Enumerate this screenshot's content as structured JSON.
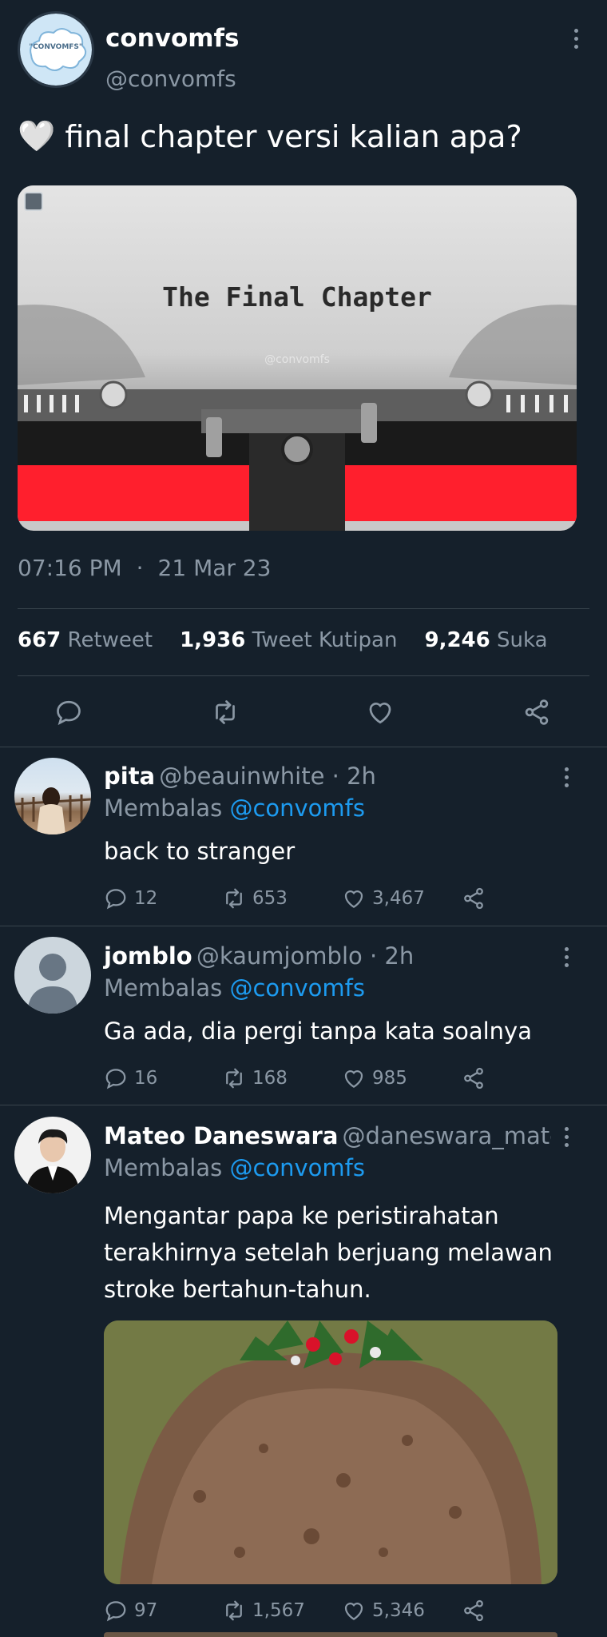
{
  "tweet": {
    "display_name": "convomfs",
    "handle": "@convomfs",
    "avatar_text": "\"CONVOMFS\"",
    "text_emoji": "🤍",
    "text": "final chapter versi kalian apa?",
    "image_caption": "The Final Chapter",
    "image_watermark": "@convomfs",
    "time": "07:16 PM",
    "separator": "·",
    "date": "21 Mar 23",
    "stats": {
      "retweets_count": "667",
      "retweets_label": "Retweet",
      "quotes_count": "1,936",
      "quotes_label": "Tweet Kutipan",
      "likes_count": "9,246",
      "likes_label": "Suka"
    }
  },
  "replies": [
    {
      "name": "pita",
      "meta": "@beauinwhite · 2h",
      "replying_label": "Membalas",
      "replying_to": "@convomfs",
      "text": "back to stranger",
      "replies": "12",
      "retweets": "653",
      "likes": "3,467"
    },
    {
      "name": "jomblo",
      "meta": "@kaumjomblo · 2h",
      "replying_label": "Membalas",
      "replying_to": "@convomfs",
      "text": "Ga ada, dia pergi tanpa kata soalnya",
      "replies": "16",
      "retweets": "168",
      "likes": "985"
    },
    {
      "name": "Mateo Daneswara",
      "meta": "@daneswara_mateo...",
      "replying_label": "Membalas",
      "replying_to": "@convomfs",
      "text_lines": [
        "Mengantar papa ke peristirahatan",
        "terakhirnya setelah berjuang melawan",
        "stroke bertahun-tahun."
      ],
      "replies": "97",
      "retweets": "1,567",
      "likes": "5,346"
    }
  ],
  "colors": {
    "background": "#15202b",
    "divider": "#38444d",
    "muted": "#8b98a5",
    "link": "#1d9bf0",
    "accent_red": "#ff1f2d"
  }
}
